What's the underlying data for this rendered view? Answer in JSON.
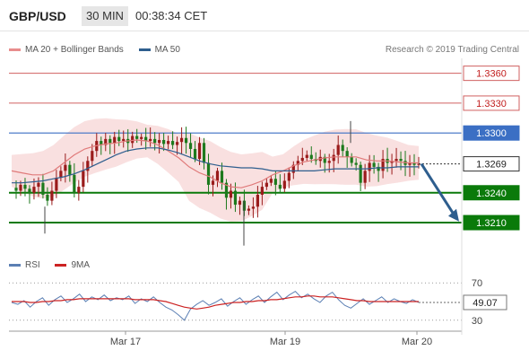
{
  "header": {
    "symbol": "GBP/USD",
    "timeframe": "30 MIN",
    "time": "00:38:34 CET"
  },
  "legend_main": [
    {
      "label": "MA 20 + Bollinger Bands",
      "color": "#e88d8d"
    },
    {
      "label": "MA 50",
      "color": "#2e5e8e"
    }
  ],
  "credit": "Research © 2019 Trading Central",
  "legend_rsi": [
    {
      "label": "RSI",
      "color": "#5b7fb3"
    },
    {
      "label": "9MA",
      "color": "#cc2222"
    }
  ],
  "colors": {
    "up": "#9a1b1b",
    "down": "#1d7a1d",
    "support": "#0a7a0a",
    "pivot_blue": "#3b6fc4",
    "resistance_red": "#d06060",
    "arrow": "#2e5e8e",
    "band_fill": "#f7d5d5"
  },
  "chart_data": [
    {
      "type": "candlestick",
      "title": "GBP/USD",
      "x_tick_labels": [
        "Mar 17",
        "Mar 19",
        "Mar 20"
      ],
      "ylim": [
        1.3183,
        1.3375
      ],
      "levels": [
        {
          "value": "1.3360",
          "kind": "resistance"
        },
        {
          "value": "1.3330",
          "kind": "resistance"
        },
        {
          "value": "1.3300",
          "kind": "pivot"
        },
        {
          "value": "1.3240",
          "kind": "support"
        },
        {
          "value": "1.3210",
          "kind": "support"
        }
      ],
      "last_price": "1.3269",
      "bar_count": 92,
      "close_path": [
        1.3245,
        1.3242,
        1.3248,
        1.3244,
        1.324,
        1.3246,
        1.325,
        1.3238,
        1.3232,
        1.3242,
        1.3255,
        1.3262,
        1.3268,
        1.3258,
        1.324,
        1.3246,
        1.3262,
        1.3272,
        1.3282,
        1.3292,
        1.3288,
        1.3294,
        1.329,
        1.3296,
        1.3292,
        1.3294,
        1.329,
        1.3297,
        1.3294,
        1.3296,
        1.3292,
        1.3294,
        1.329,
        1.3293,
        1.3289,
        1.3292,
        1.3288,
        1.3291,
        1.3295,
        1.329,
        1.3284,
        1.3274,
        1.329,
        1.327,
        1.3248,
        1.3252,
        1.3262,
        1.325,
        1.3235,
        1.3242,
        1.3228,
        1.3232,
        1.3222,
        1.3224,
        1.3226,
        1.3238,
        1.3246,
        1.325,
        1.3254,
        1.3248,
        1.3244,
        1.3252,
        1.326,
        1.3268,
        1.3272,
        1.3275,
        1.3278,
        1.3274,
        1.3272,
        1.3276,
        1.327,
        1.3272,
        1.3278,
        1.3288,
        1.3282,
        1.3276,
        1.327,
        1.3268,
        1.325,
        1.3262,
        1.327,
        1.3266,
        1.3262,
        1.3274,
        1.327,
        1.3272,
        1.3274,
        1.3272,
        1.3268,
        1.327,
        1.3268,
        1.3269
      ],
      "ma20": [
        1.3262,
        1.326,
        1.3258,
        1.3258,
        1.3262,
        1.327,
        1.3278,
        1.3284,
        1.3287,
        1.3289,
        1.329,
        1.3292,
        1.3293,
        1.3292,
        1.3288,
        1.3282,
        1.3275,
        1.3266,
        1.326,
        1.3256,
        1.325,
        1.3246,
        1.3245,
        1.3248,
        1.3252,
        1.3258,
        1.3262,
        1.3267,
        1.3271,
        1.3273,
        1.3275,
        1.3276,
        1.3276,
        1.3276,
        1.3273,
        1.3272,
        1.3272,
        1.3271,
        1.327,
        1.327
      ],
      "ma50": [
        1.325,
        1.325,
        1.3251,
        1.3252,
        1.3254,
        1.3256,
        1.3259,
        1.3263,
        1.3268,
        1.3273,
        1.3278,
        1.3282,
        1.3284,
        1.3285,
        1.3285,
        1.3283,
        1.328,
        1.3276,
        1.3272,
        1.3269,
        1.3267,
        1.3266,
        1.3265,
        1.3265,
        1.3264,
        1.3262,
        1.3262,
        1.3262,
        1.3262,
        1.3262,
        1.3263,
        1.3264,
        1.3264,
        1.3264,
        1.3264,
        1.3265,
        1.3265,
        1.3266,
        1.3266,
        1.3266
      ]
    },
    {
      "type": "line",
      "title": "RSI",
      "ylim": [
        25,
        75
      ],
      "y_ticks": [
        "70",
        "30"
      ],
      "last_value": "49.07",
      "series": [
        {
          "name": "RSI",
          "values": [
            49,
            47,
            51,
            44,
            50,
            54,
            46,
            52,
            56,
            49,
            53,
            58,
            50,
            55,
            52,
            57,
            51,
            54,
            52,
            56,
            48,
            53,
            50,
            55,
            49,
            44,
            41,
            36,
            30,
            42,
            47,
            51,
            46,
            49,
            53,
            45,
            50,
            54,
            47,
            52,
            56,
            49,
            55,
            60,
            52,
            57,
            61,
            54,
            58,
            53,
            49,
            56,
            60,
            52,
            46,
            43,
            48,
            53,
            47,
            51,
            55,
            49,
            53,
            50,
            48,
            52,
            49
          ]
        },
        {
          "name": "9MA",
          "values": [
            50,
            50,
            50,
            49,
            49,
            50,
            50,
            51,
            51,
            52,
            52,
            53,
            53,
            53,
            53,
            53,
            53,
            53,
            53,
            53,
            52,
            52,
            52,
            52,
            51,
            50,
            48,
            46,
            44,
            43,
            42,
            43,
            44,
            46,
            47,
            48,
            49,
            49,
            50,
            50,
            51,
            51,
            52,
            52,
            53,
            54,
            55,
            55,
            56,
            56,
            55,
            55,
            55,
            54,
            53,
            52,
            51,
            51,
            50,
            50,
            50,
            50,
            50,
            50,
            50,
            50,
            50
          ]
        }
      ]
    }
  ]
}
